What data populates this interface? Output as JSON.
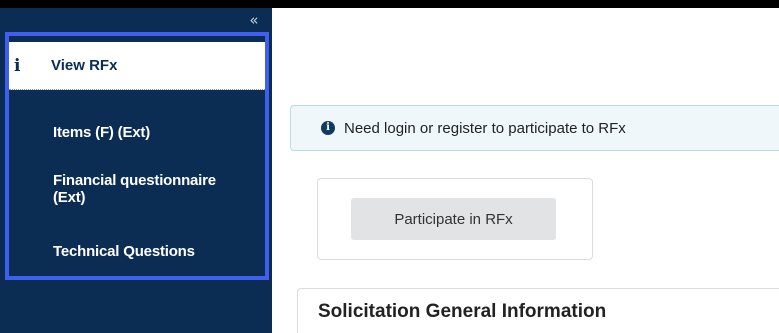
{
  "sidebar": {
    "collapse_glyph": "«",
    "active_item": {
      "icon": "info-icon",
      "icon_glyph": "i",
      "label": "View RFx"
    },
    "items": [
      {
        "label": "Items (F) (Ext)"
      },
      {
        "label": "Financial questionnaire (Ext)"
      },
      {
        "label": "Technical Questions"
      }
    ]
  },
  "main": {
    "notice": {
      "icon": "info-circle-icon",
      "icon_glyph": "i",
      "text": "Need login or register to participate to RFx"
    },
    "participate_button": "Participate in RFx",
    "section_title": "Solicitation General Information"
  },
  "colors": {
    "sidebar_bg": "#0b2c53",
    "highlight": "#3e5ff0",
    "notice_bg": "#eff7fb",
    "button_bg": "#e2e3e5"
  }
}
